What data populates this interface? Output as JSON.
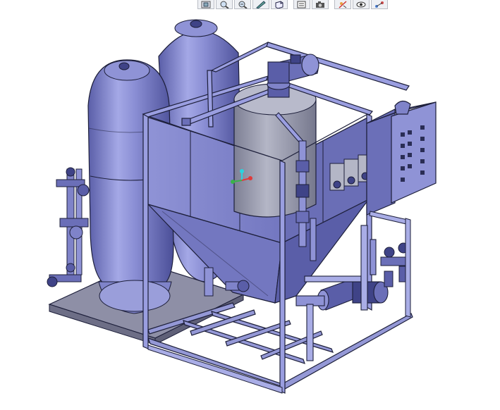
{
  "toolbar": {
    "buttons": [
      {
        "name": "fit-all",
        "icon": "fit-all-icon"
      },
      {
        "name": "zoom-in",
        "icon": "zoom-in-icon"
      },
      {
        "name": "zoom-out",
        "icon": "zoom-out-icon"
      },
      {
        "name": "normal-view",
        "icon": "normal-view-icon"
      },
      {
        "name": "iso-view",
        "icon": "iso-view-icon"
      },
      {
        "name": "view-mode",
        "icon": "view-mode-icon"
      },
      {
        "name": "capture",
        "icon": "camera-icon"
      },
      {
        "name": "hide-show",
        "icon": "hide-show-icon"
      },
      {
        "name": "swap-visible",
        "icon": "eye-icon"
      },
      {
        "name": "measure",
        "icon": "measure-icon"
      }
    ]
  },
  "colors": {
    "model_fill": "#7f83c9",
    "model_light": "#a9ade6",
    "model_dark": "#3f4387",
    "edge": "#1d1f3a",
    "base_plate": "#8e8fa6",
    "motor": "#6b6fb8",
    "tank_grey": "#9a9cb0"
  },
  "compass": {
    "x_color": "#e03a3a",
    "y_color": "#3ab34a",
    "z_color": "#2ad4e0"
  }
}
